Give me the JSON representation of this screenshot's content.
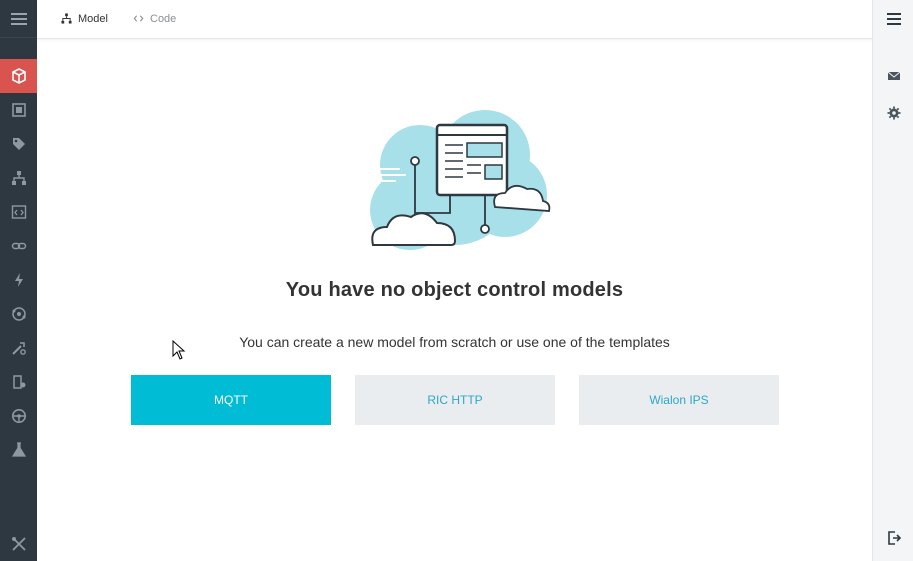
{
  "tabs": [
    {
      "label": "Model",
      "icon": "hierarchy-icon",
      "active": true
    },
    {
      "label": "Code",
      "icon": "code-icon",
      "active": false
    }
  ],
  "sidebar": {
    "items": [
      {
        "name": "cube-icon",
        "active": true
      },
      {
        "name": "frame-icon"
      },
      {
        "name": "tag-icon"
      },
      {
        "name": "hierarchy-icon"
      },
      {
        "name": "code-window-icon"
      },
      {
        "name": "link-icon"
      },
      {
        "name": "bolt-icon"
      },
      {
        "name": "atom-icon"
      },
      {
        "name": "tools-icon"
      },
      {
        "name": "gear-device-icon"
      },
      {
        "name": "wheel-icon"
      },
      {
        "name": "flask-icon"
      }
    ],
    "bottom": {
      "name": "wrench-icon"
    }
  },
  "rightbar": {
    "items": [
      "hamburger-icon",
      "envelope-icon",
      "gear-icon"
    ],
    "bottom": "logout-icon"
  },
  "empty_state": {
    "title": "You have no object control models",
    "subtitle": "You can create a new model from scratch or use one of the templates"
  },
  "templates": [
    {
      "label": "MQTT",
      "style": "primary"
    },
    {
      "label": "RIC HTTP",
      "style": "secondary"
    },
    {
      "label": "Wialon IPS",
      "style": "secondary"
    }
  ],
  "colors": {
    "sidebar_bg": "#2e3841",
    "active_red": "#d9534f",
    "accent_cyan": "#00bcd4",
    "cloud_cyan": "#a8e0ea"
  }
}
